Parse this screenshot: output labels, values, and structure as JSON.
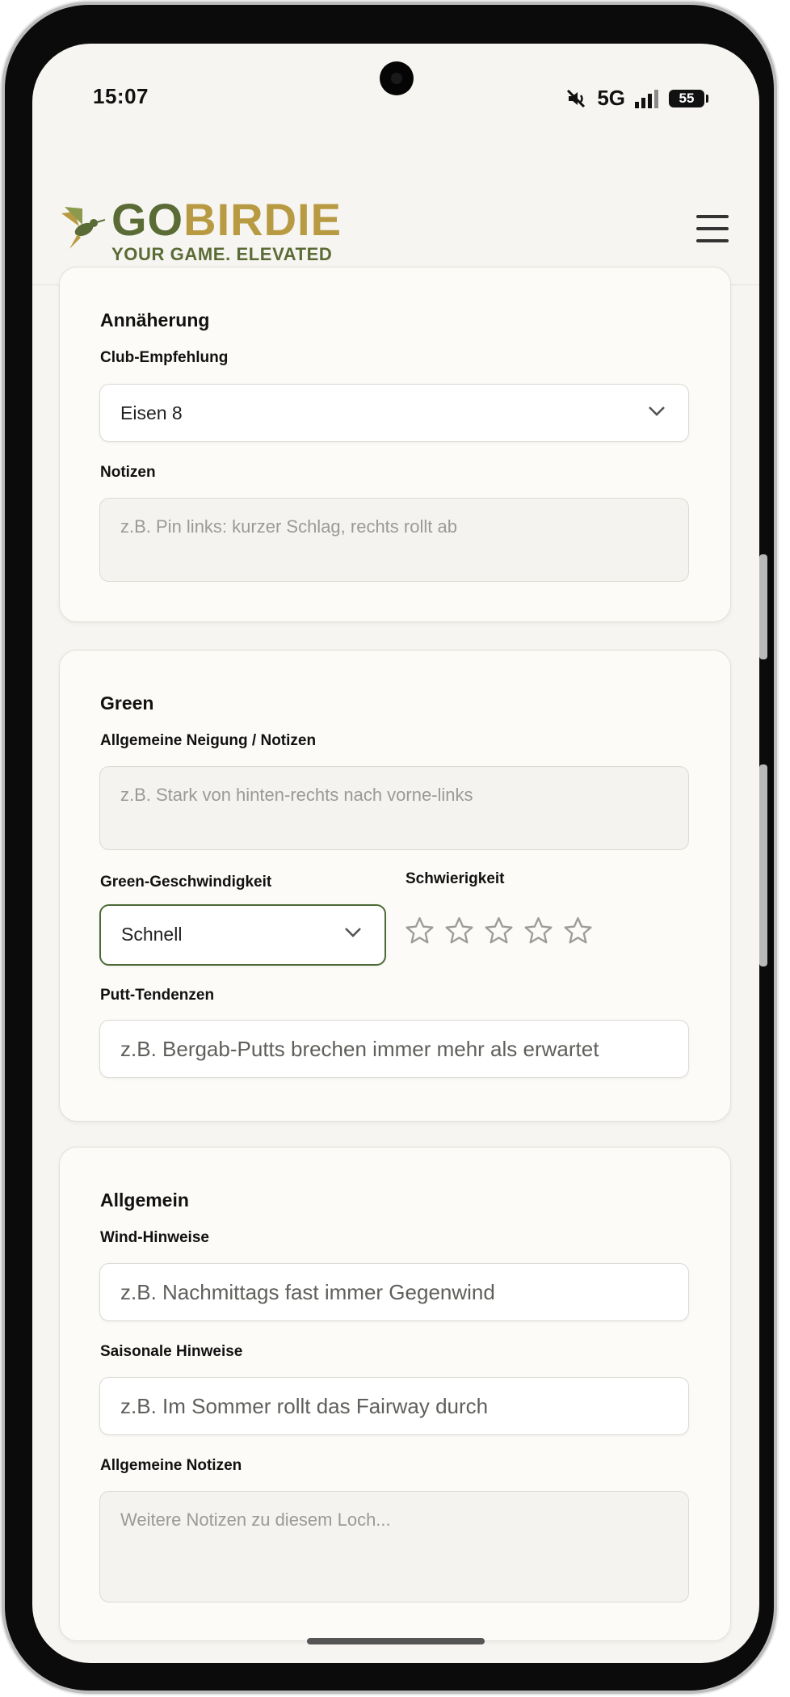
{
  "status_bar": {
    "time": "15:07",
    "network": "5G",
    "battery": "55"
  },
  "header": {
    "brand_go": "GO",
    "brand_birdie": "BIRDIE",
    "tagline": "YOUR GAME. ELEVATED"
  },
  "approach": {
    "title": "Annäherung",
    "club_label": "Club-Empfehlung",
    "club_value": "Eisen 8",
    "notes_label": "Notizen",
    "notes_placeholder": "z.B. Pin links: kurzer Schlag, rechts rollt ab"
  },
  "green": {
    "title": "Green",
    "slope_label": "Allgemeine Neigung / Notizen",
    "slope_placeholder": "z.B. Stark von hinten-rechts nach vorne-links",
    "speed_label": "Green-Geschwindigkeit",
    "speed_value": "Schnell",
    "difficulty_label": "Schwierigkeit",
    "difficulty_rating": 0,
    "difficulty_max": 5,
    "putt_label": "Putt-Tendenzen",
    "putt_placeholder": "z.B. Bergab-Putts brechen immer mehr als erwartet"
  },
  "general": {
    "title": "Allgemein",
    "wind_label": "Wind-Hinweise",
    "wind_placeholder": "z.B. Nachmittags fast immer Gegenwind",
    "season_label": "Saisonale Hinweise",
    "season_placeholder": "z.B. Im Sommer rollt das Fairway durch",
    "notes_label": "Allgemeine Notizen",
    "notes_placeholder": "Weitere Notizen zu diesem Loch..."
  },
  "colors": {
    "brand_green": "#5a6b35",
    "brand_gold": "#b89a42",
    "active_border": "#4d6a36"
  }
}
